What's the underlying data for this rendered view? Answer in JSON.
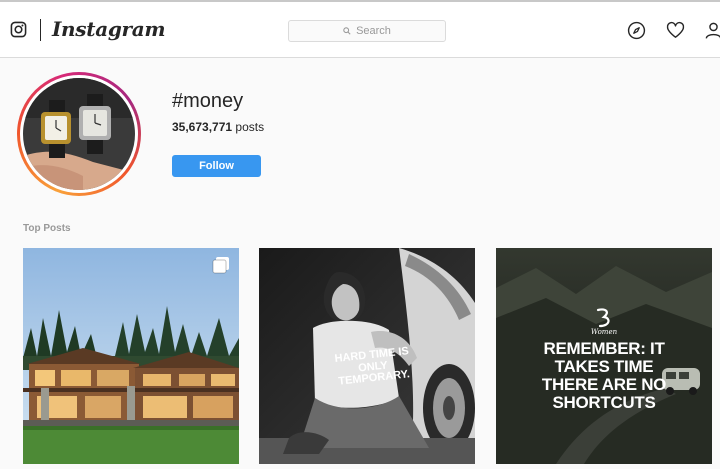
{
  "navbar": {
    "brand": "Instagram",
    "search_placeholder": "Search",
    "icons": [
      "camera-icon",
      "explore-icon",
      "heart-icon",
      "profile-icon"
    ]
  },
  "tag": {
    "title": "#money",
    "post_count": "35,673,771",
    "post_suffix": "posts",
    "follow_label": "Follow"
  },
  "section": {
    "top_posts_label": "Top Posts"
  },
  "posts": [
    {
      "kind": "house photo",
      "multi": true,
      "caption": ""
    },
    {
      "kind": "quote",
      "multi": false,
      "caption": "HARD TIME IS ONLY TEMPORARY."
    },
    {
      "kind": "quote",
      "multi": false,
      "brand": "Women",
      "caption": "REMEMBER: IT TAKES TIME THERE ARE NO SHORTCUTS"
    }
  ],
  "colors": {
    "accent": "#3897f0",
    "muted": "#999999",
    "text": "#262626",
    "border": "#dbdbdb"
  }
}
